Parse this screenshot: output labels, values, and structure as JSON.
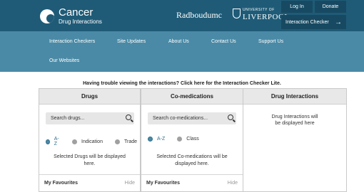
{
  "header": {
    "brand_title": "Cancer",
    "brand_subtitle": "Drug Interactions",
    "radboud": "Radboudumc",
    "liverpool_small": "UNIVERSITY OF",
    "liverpool_big": "LIVERPOOL",
    "login_label": "Log In",
    "donate_label": "Donate",
    "checker_label": "Interaction Checker",
    "checker_arrow": "→"
  },
  "nav": {
    "items": [
      "Interaction Checkers",
      "Site Updates",
      "About Us",
      "Contact Us",
      "Support Us",
      "Our Websites"
    ]
  },
  "notice": "Having trouble viewing the interactions? Click here for the Interaction Checker Lite.",
  "drugs": {
    "title": "Drugs",
    "search_placeholder": "Search drugs...",
    "filters": [
      "A-Z",
      "Indication",
      "Trade"
    ],
    "selected_filter": "A-Z",
    "empty_text": "Selected Drugs will be displayed here.",
    "favourites_label": "My Favourites",
    "hide_label": "Hide"
  },
  "comeds": {
    "title": "Co-medications",
    "search_placeholder": "Search co-medications...",
    "filters": [
      "A-Z",
      "Class"
    ],
    "selected_filter": "A-Z",
    "empty_text": "Selected Co-medications will be displayed here.",
    "favourites_label": "My Favourites",
    "hide_label": "Hide"
  },
  "interactions": {
    "title": "Drug Interactions",
    "empty_text": "Drug Interactions will be displayed here"
  },
  "colors": {
    "header_bg": "#1f5b77",
    "nav_bg": "#4a8aa6",
    "accent": "#2f6f8c"
  }
}
